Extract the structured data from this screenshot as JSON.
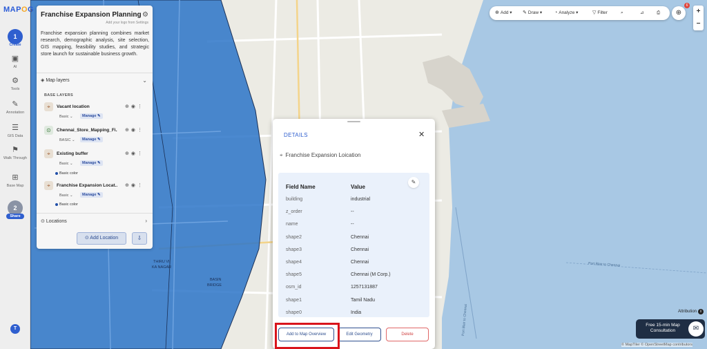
{
  "brand": {
    "logo_left": "MAP",
    "logo_accent": "O",
    "logo_right": "G"
  },
  "rail": {
    "steps": [
      {
        "num": "1",
        "label": "Create"
      },
      {
        "num": "2",
        "label": "Share"
      }
    ],
    "items": [
      {
        "label": "AI",
        "icon": "ai-icon"
      },
      {
        "label": "Tools",
        "icon": "tools-icon"
      },
      {
        "label": "Annotation",
        "icon": "annotation-icon"
      },
      {
        "label": "GIS Data",
        "icon": "gis-data-icon"
      },
      {
        "label": "Walk Through",
        "icon": "walk-through-icon"
      },
      {
        "label": "Base Map",
        "icon": "base-map-icon"
      }
    ],
    "avatar": "T"
  },
  "panel": {
    "title": "Franchise Expansion Planning",
    "subtitle": "Add your logo from Settings",
    "description": "Franchise expansion planning combines market research, demographic analysis, site selection, GIS mapping, feasibility studies, and strategic store launch for sustainable business growth.",
    "map_layers_label": "Map layers",
    "base_layers_label": "BASE LAYERS",
    "layers": [
      {
        "name": "Vacant location",
        "style": "Basic",
        "manage": "Manage",
        "color_label": ""
      },
      {
        "name": "Chennai_Store_Mapping_Fi...",
        "style": "BASIC",
        "manage": "Manage",
        "color_label": ""
      },
      {
        "name": "Existing buffer",
        "style": "Basic",
        "manage": "Manage",
        "color_label": "Basic color"
      },
      {
        "name": "Franchise Expansion Locat...",
        "style": "Basic",
        "manage": "Manage",
        "color_label": "Basic color"
      }
    ],
    "locations_label": "Locations",
    "add_location_label": "Add Location"
  },
  "toolbar": {
    "add": "Add",
    "draw": "Draw",
    "analyze": "Analyze",
    "filter": "Filter"
  },
  "notification_count": "6",
  "details": {
    "title": "DETAILS",
    "layer_name": "Franchise Expansion Loication",
    "col_field": "Field Name",
    "col_value": "Value",
    "rows": [
      {
        "field": "building",
        "value": "industrial"
      },
      {
        "field": "z_order",
        "value": "--"
      },
      {
        "field": "name",
        "value": "--"
      },
      {
        "field": "shape2",
        "value": "Chennai"
      },
      {
        "field": "shape3",
        "value": "Chennai"
      },
      {
        "field": "shape4",
        "value": "Chennai"
      },
      {
        "field": "shape5",
        "value": "Chennai (M Corp.)"
      },
      {
        "field": "osm_id",
        "value": "1257131887"
      },
      {
        "field": "shape1",
        "value": "Tamil Nadu"
      },
      {
        "field": "shape0",
        "value": "India"
      }
    ],
    "btn_add_overview": "Add to Map Overview",
    "btn_edit_geometry": "Edit Geometry",
    "btn_delete": "Delete"
  },
  "map_labels": {
    "thiru": "THIRU VI",
    "ka_nagar": "KA NAGAR",
    "basin": "BASIN",
    "bridge": "BRIDGE",
    "port_blair_1": "Port Blair to Chennai",
    "port_blair_2": "Port Blair to Chennai"
  },
  "attribution_label": "Attribution",
  "consult_label": "Free 15-min Map Consultation",
  "credits": "© MapTiler © OpenStreetMap contributors",
  "colors": {
    "accent": "#2f5fcf",
    "polygon": "#2c74c8",
    "sea": "#a8c8e4",
    "land": "#ecebe4",
    "highlight": "#d9141b"
  }
}
